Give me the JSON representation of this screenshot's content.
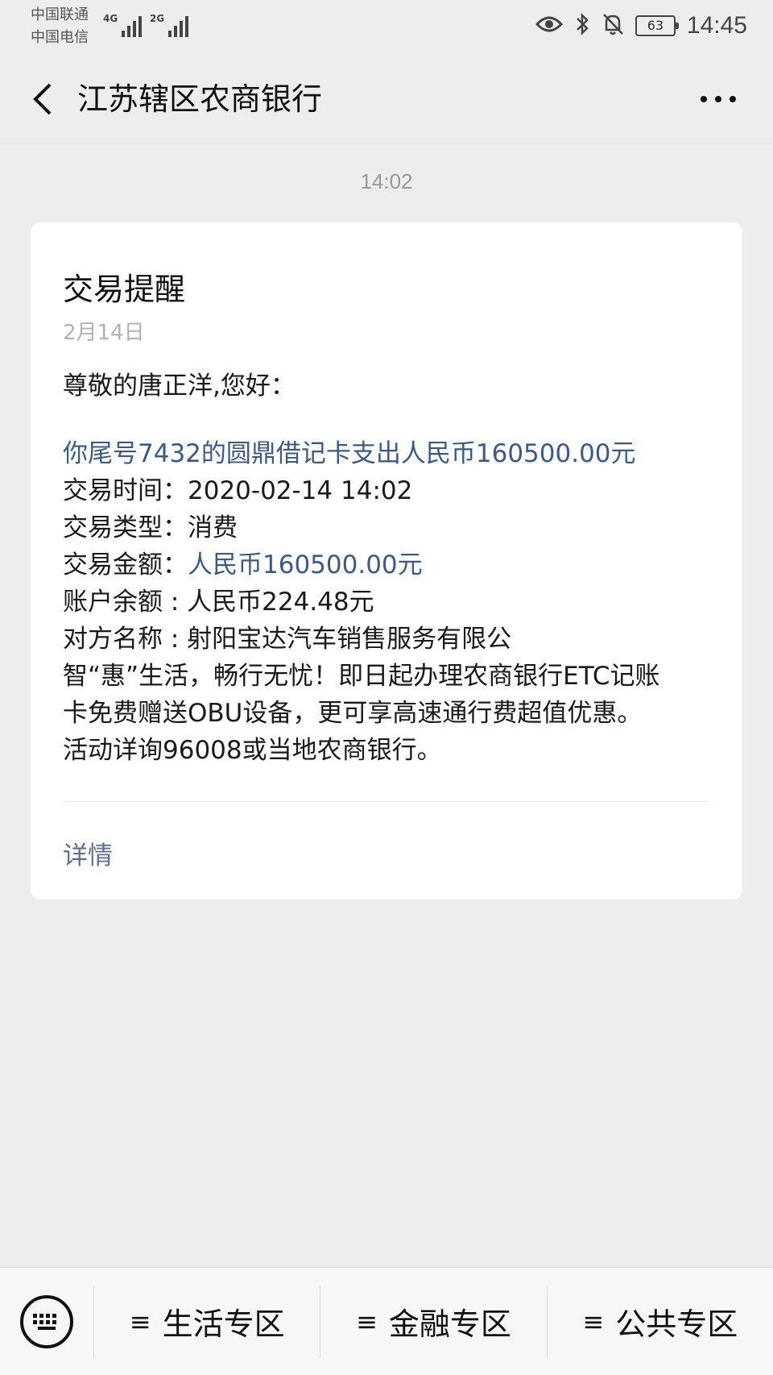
{
  "status_bar": {
    "carrier_1": "中国联通",
    "carrier_2": "中国电信",
    "net_1": "4G",
    "net_2": "2G",
    "battery": "63",
    "time": "14:45",
    "icons": [
      "eye-comfort-icon",
      "bluetooth-icon",
      "mute-bell-icon",
      "battery-icon"
    ]
  },
  "nav": {
    "title": "江苏辖区农商银行",
    "back_icon": "chevron-left-icon",
    "more_icon": "more-dots-icon"
  },
  "chat": {
    "message_time": "14:02"
  },
  "card": {
    "title": "交易提醒",
    "date": "2月14日",
    "greeting": "尊敬的唐正洋,您好：",
    "summary": "你尾号7432的圆鼎借记卡支出人民币160500.00元",
    "rows": {
      "time_label": "交易时间：",
      "time_value": "2020-02-14 14:02",
      "type_label": "交易类型：",
      "type_value": "消费",
      "amount_label": "交易金额：",
      "amount_value": "人民币160500.00元",
      "balance_label": "账户余额 : ",
      "balance_value": "人民币224.48元",
      "counterparty_label": "对方名称 : ",
      "counterparty_value": "射阳宝达汽车销售服务有限公"
    },
    "promo_1": "智“惠”生活，畅行无忧！即日起办理农商银行ETC记账",
    "promo_2": "卡免费赠送OBU设备，更可享高速通行费超值优惠。",
    "promo_3": "活动详询96008或当地农商银行。",
    "detail_link": "详情",
    "accent_color": "#3a5b8a"
  },
  "bottom_menu": {
    "keyboard_icon": "keyboard-icon",
    "items": [
      {
        "label": "生活专区"
      },
      {
        "label": "金融专区"
      },
      {
        "label": "公共专区"
      }
    ],
    "menu_glyph": "≡"
  }
}
